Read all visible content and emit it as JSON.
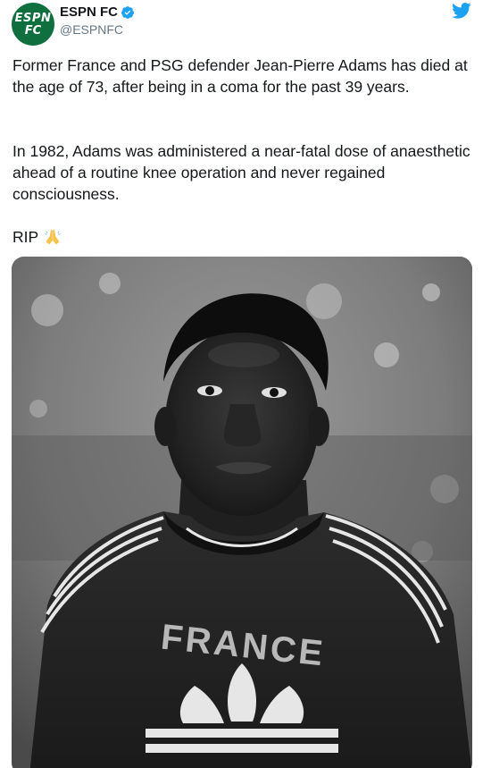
{
  "account": {
    "display_name": "ESPN FC",
    "handle": "@ESPNFC",
    "avatar_line1": "ESPN",
    "avatar_line2": "FC",
    "verified": true,
    "avatar_color": "#0f6f3e"
  },
  "tweet": {
    "paragraph1": "Former France and PSG defender Jean-Pierre Adams has died at the age of 73, after being in a coma for the past 39 years.",
    "paragraph2": "In 1982, Adams was administered a near-fatal dose of anaesthetic ahead of a routine knee operation and never regained consciousness.",
    "paragraph3": "RIP",
    "emoji": "folded-hands",
    "photo_jersey_text": "FRANCE"
  },
  "icons": {
    "platform": "twitter-bird-icon",
    "verified": "verified-badge-icon"
  },
  "colors": {
    "twitter_blue": "#1da1f2",
    "text": "#14171a",
    "secondary": "#657786"
  }
}
